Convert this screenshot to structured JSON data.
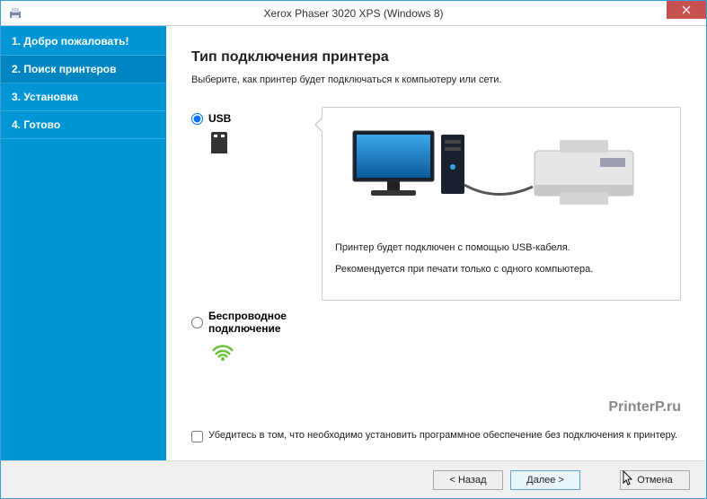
{
  "window": {
    "title": "Xerox Phaser 3020 XPS (Windows 8)"
  },
  "sidebar": {
    "steps": [
      {
        "label": "1. Добро пожаловать!"
      },
      {
        "label": "2. Поиск принтеров"
      },
      {
        "label": "3. Установка"
      },
      {
        "label": "4. Готово"
      }
    ]
  },
  "main": {
    "heading": "Тип подключения принтера",
    "subheading": "Выберите, как принтер будет подключаться к компьютеру или сети.",
    "options": {
      "usb": {
        "label": "USB"
      },
      "wireless": {
        "label": "Беспроводное подключение"
      }
    },
    "usb_detail": {
      "line1": "Принтер будет подключен с помощью USB-кабеля.",
      "line2": "Рекомендуется при печати только с одного компьютера."
    },
    "checkbox_label": "Убедитесь в том, что необходимо установить программное обеспечение без подключения к принтеру."
  },
  "footer": {
    "back": "< Назад",
    "next": "Далее >",
    "cancel": "Отмена"
  },
  "watermark": "PrinterP.ru"
}
